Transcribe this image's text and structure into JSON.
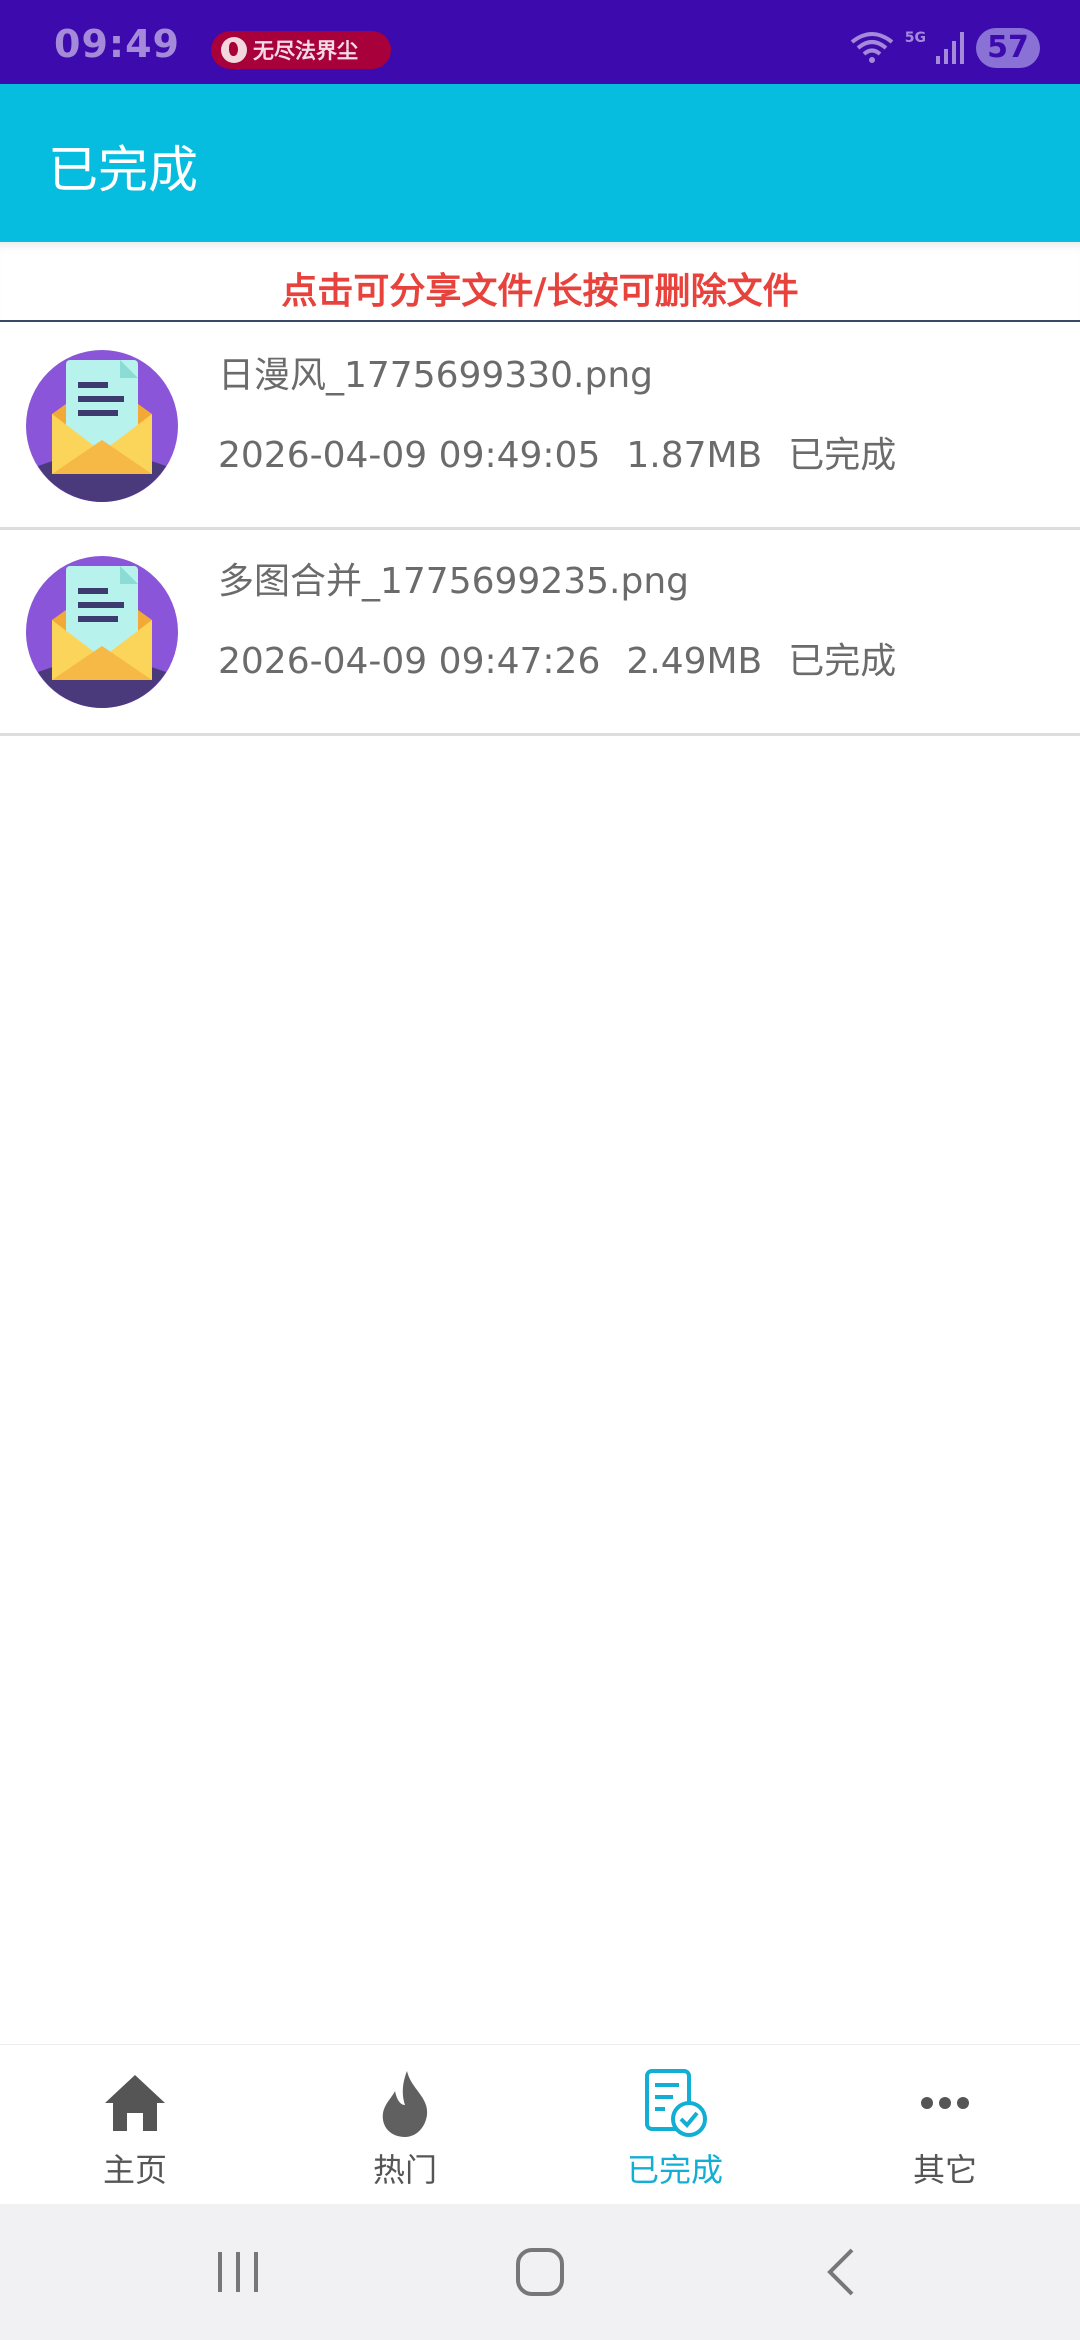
{
  "status_bar": {
    "time": "09:49",
    "notification_pill": "无尽法界尘",
    "network": "5G",
    "battery": "57"
  },
  "app_bar": {
    "title": "已完成"
  },
  "hint": "点击可分享文件/长按可删除文件",
  "files": [
    {
      "name": "日漫风_1775699330.png",
      "date": "2026-04-09 09:49:05",
      "size": "1.87MB",
      "status": "已完成"
    },
    {
      "name": "多图合并_1775699235.png",
      "date": "2026-04-09 09:47:26",
      "size": "2.49MB",
      "status": "已完成"
    }
  ],
  "bottom_nav": {
    "items": [
      {
        "label": "主页",
        "icon": "home-icon",
        "active": false
      },
      {
        "label": "热门",
        "icon": "flame-icon",
        "active": false
      },
      {
        "label": "已完成",
        "icon": "completed-doc-icon",
        "active": true
      },
      {
        "label": "其它",
        "icon": "more-icon",
        "active": false
      }
    ]
  },
  "colors": {
    "status_bar": "#3d0aad",
    "app_bar": "#06bcdf",
    "hint": "#e8423d",
    "active_nav": "#13aed3"
  }
}
